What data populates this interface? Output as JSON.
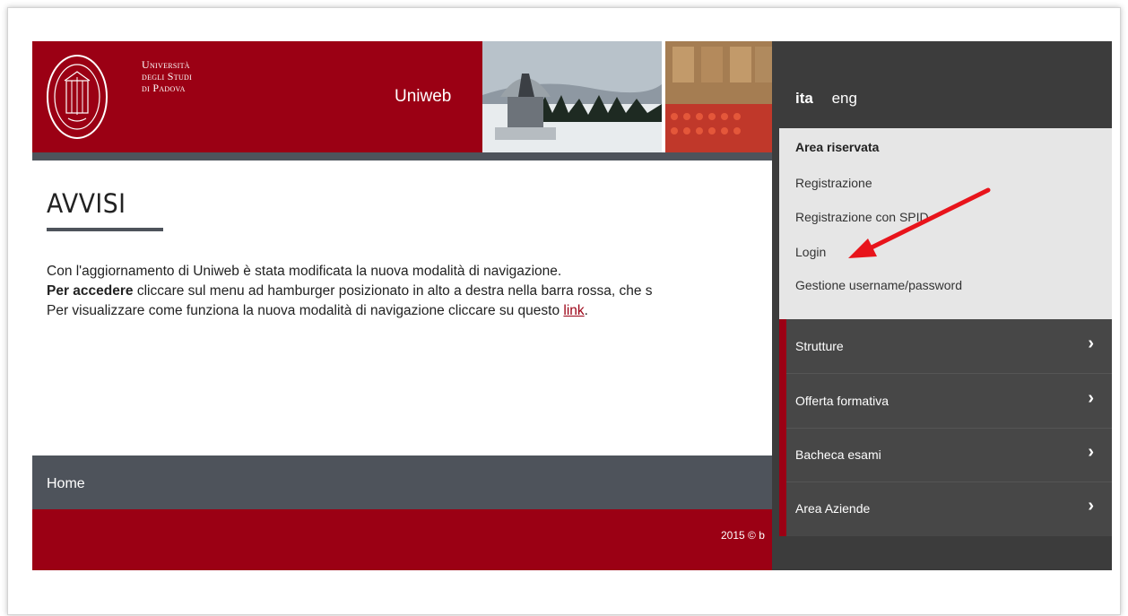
{
  "header": {
    "university_line1": "Università",
    "university_line2": "degli Studi",
    "university_line3": "di Padova",
    "app_title": "Uniweb"
  },
  "content": {
    "title": "AVVISI",
    "line1": "Con l'aggiornamento di Uniweb è stata modificata la nuova modalità di navigazione.",
    "line2_bold": "Per accedere",
    "line2_rest": " cliccare sul menu ad hamburger posizionato in alto a destra nella barra rossa, che s",
    "line3_prefix": "Per visualizzare come funziona la nuova modalità di navigazione cliccare su questo ",
    "line3_link": "link",
    "line3_suffix": "."
  },
  "footer": {
    "home_label": "Home",
    "copyright": "2015 © b"
  },
  "side_menu": {
    "languages": [
      {
        "label": "ita",
        "active": true
      },
      {
        "label": "eng",
        "active": false
      }
    ],
    "area_riservata": {
      "title": "Area riservata",
      "items": [
        "Registrazione",
        "Registrazione con SPID",
        "Login",
        "Gestione username/password"
      ]
    },
    "nav_items": [
      {
        "label": "Strutture",
        "chevron": "›"
      },
      {
        "label": "Offerta formativa",
        "chevron": "›"
      },
      {
        "label": "Bacheca esami",
        "chevron": "›"
      },
      {
        "label": "Area Aziende",
        "chevron": "›"
      }
    ]
  },
  "colors": {
    "brand_red": "#9b0014",
    "dark_gray": "#4e535b",
    "menu_dark": "#3c3c3c",
    "annotation_arrow": "#e8141b"
  }
}
